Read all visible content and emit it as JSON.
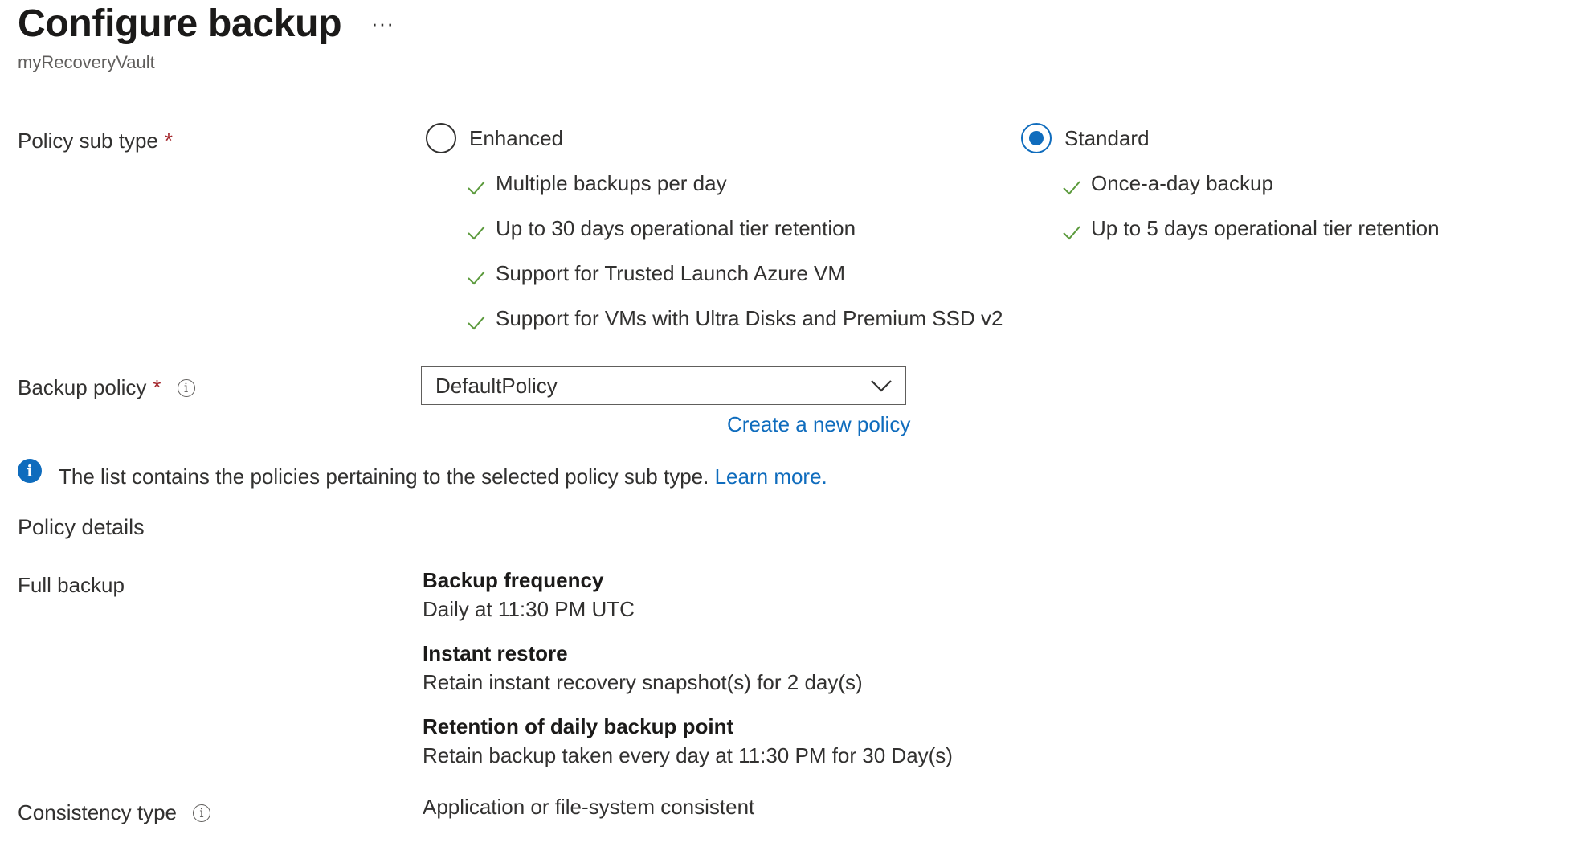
{
  "header": {
    "title": "Configure backup",
    "more_label": "···",
    "subtitle": "myRecoveryVault"
  },
  "policy_sub_type": {
    "label": "Policy sub type",
    "required_mark": "*",
    "options": [
      {
        "label": "Enhanced",
        "selected": false,
        "features": [
          "Multiple backups per day",
          "Up to 30 days operational tier retention",
          "Support for Trusted Launch Azure VM",
          "Support for VMs with Ultra Disks and Premium SSD v2"
        ]
      },
      {
        "label": "Standard",
        "selected": true,
        "features": [
          "Once-a-day backup",
          "Up to 5 days operational tier retention"
        ]
      }
    ]
  },
  "backup_policy": {
    "label": "Backup policy",
    "required_mark": "*",
    "info_icon": "info-icon",
    "selected_value": "DefaultPolicy",
    "create_link": "Create a new policy"
  },
  "info_banner": {
    "icon": "info-icon",
    "text": "The list contains the policies pertaining to the selected policy sub type.",
    "link": "Learn more."
  },
  "policy_details": {
    "heading": "Policy details",
    "full_backup_label": "Full backup",
    "items": [
      {
        "title": "Backup frequency",
        "value": "Daily at 11:30 PM UTC"
      },
      {
        "title": "Instant restore",
        "value": "Retain instant recovery snapshot(s) for 2 day(s)"
      },
      {
        "title": "Retention of daily backup point",
        "value": "Retain backup taken every day at 11:30 PM for 30 Day(s)"
      }
    ],
    "consistency_label": "Consistency type",
    "consistency_value": "Application or file-system consistent"
  },
  "colors": {
    "accent": "#0f6cbd",
    "required": "#a4262c",
    "check": "#5b9a3c"
  }
}
